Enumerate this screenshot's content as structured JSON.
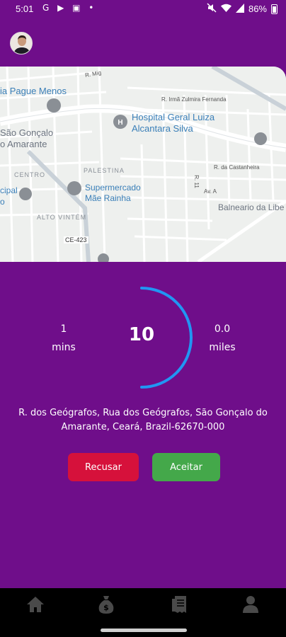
{
  "status_bar": {
    "time": "5:01",
    "left_icons": "G ▶ ▣ •",
    "battery": "86%"
  },
  "map": {
    "labels": [
      {
        "id": "pague-menos",
        "text": "ia Pague Menos"
      },
      {
        "id": "hospital",
        "text": "Hospital Geral Luiza"
      },
      {
        "id": "hospital2",
        "text": "Alcantara Silva"
      },
      {
        "id": "sao-goncalo",
        "text": "São Gonçalo"
      },
      {
        "id": "amarante",
        "text": "o Amarante"
      },
      {
        "id": "palestina",
        "text": "PALESTINA"
      },
      {
        "id": "centro",
        "text": "CENTRO"
      },
      {
        "id": "supermercado",
        "text": "Supermercado"
      },
      {
        "id": "mae-rainha",
        "text": "Mãe Rainha"
      },
      {
        "id": "alto-vintem",
        "text": "ALTO VINTÉM"
      },
      {
        "id": "cicipal",
        "text": "cipal"
      },
      {
        "id": "cicipal2",
        "text": "o"
      },
      {
        "id": "ce423",
        "text": "CE-423"
      },
      {
        "id": "balneario",
        "text": "Balneario da Libe"
      },
      {
        "id": "r-irma",
        "text": "R. Irmã Zulmira Fernanda"
      },
      {
        "id": "r-castanheira",
        "text": "R. da Castanheira"
      },
      {
        "id": "r-mi",
        "text": "R. Mig"
      },
      {
        "id": "av-a",
        "text": "Av. A"
      },
      {
        "id": "r-11",
        "text": "R. 11"
      }
    ]
  },
  "timer": {
    "value": "10",
    "progress": 0.5
  },
  "eta": {
    "value": "1",
    "unit": "mins"
  },
  "distance": {
    "value": "0.0",
    "unit": "miles"
  },
  "address": "R. dos Geógrafos, Rua dos Geógrafos, São Gonçalo do Amarante, Ceará, Brazil-62670-000",
  "buttons": {
    "reject": "Recusar",
    "accept": "Aceitar"
  },
  "colors": {
    "background": "#6f0e8a",
    "timer_ring": "#2196f3",
    "reject": "#d6113b",
    "accept": "#44a84a"
  },
  "bottom_nav": [
    {
      "icon": "home-icon"
    },
    {
      "icon": "money-bag-icon"
    },
    {
      "icon": "receipt-icon"
    },
    {
      "icon": "profile-icon"
    }
  ]
}
